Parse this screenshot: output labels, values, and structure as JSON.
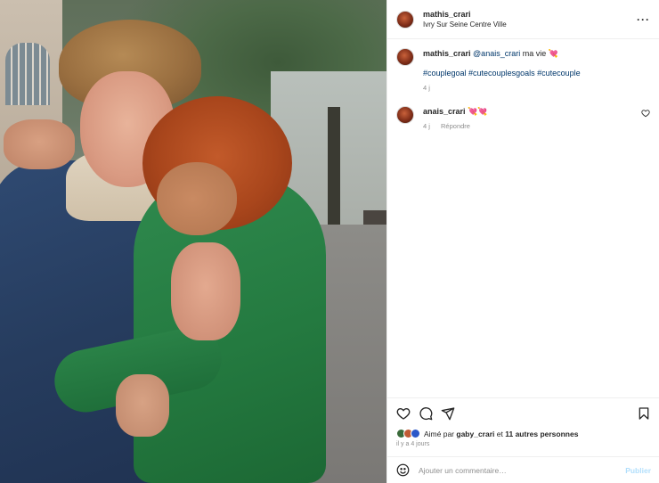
{
  "post": {
    "author": "mathis_crari",
    "location": "Ivry Sur Seine Centre Ville",
    "more_icon": "more-horizontal-icon"
  },
  "caption": {
    "user": "mathis_crari",
    "mention": "@anais_crari",
    "text": "ma vie",
    "emoji": "💘",
    "hashtags": "#couplegoal #cutecouplesgoals #cutecouple",
    "age": "4 j"
  },
  "comments": [
    {
      "user": "anais_crari",
      "emoji": "💘💘",
      "age": "4 j",
      "reply_label": "Répondre"
    }
  ],
  "actions": {
    "icons": [
      "heart-icon",
      "comment-icon",
      "share-icon",
      "bookmark-icon"
    ],
    "liked_prefix": "Aimé par",
    "liked_user": "gaby_crari",
    "liked_conj": "et",
    "liked_others": "11 autres personnes",
    "time": "il y a 4 jours"
  },
  "comment_box": {
    "placeholder": "Ajouter un commentaire…",
    "publish_label": "Publier"
  },
  "colors": {
    "link": "#00376b",
    "publish_disabled": "#b2dffc",
    "muted": "#8e8e8e"
  }
}
